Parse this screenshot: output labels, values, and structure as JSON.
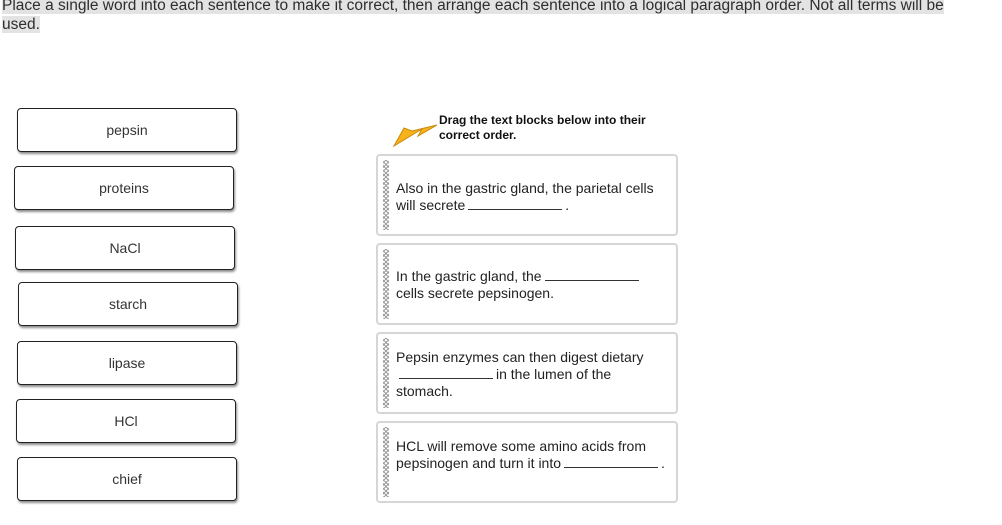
{
  "instructions": "Place a single word into each sentence to make it correct, then arrange each sentence into a logical paragraph order. Not all terms will be used.",
  "word_bank": [
    "pepsin",
    "proteins",
    "NaCl",
    "starch",
    "lipase",
    "HCl",
    "chief"
  ],
  "drag_hint": {
    "line1": "Drag the text blocks below into their",
    "line2": "correct order.",
    "icon": "arrow-pointer-icon",
    "arrow_color": "#f5b21a"
  },
  "sentences": [
    {
      "before": "Also in the gastric gland, the parietal cells will secrete",
      "after": "."
    },
    {
      "before": "In the gastric gland, the",
      "after": "cells secrete pepsinogen."
    },
    {
      "before": "Pepsin enzymes can then digest dietary",
      "after": "in the lumen of the stomach."
    },
    {
      "before": "HCL will remove some amino acids from pepsinogen and turn it into",
      "after": "."
    }
  ]
}
